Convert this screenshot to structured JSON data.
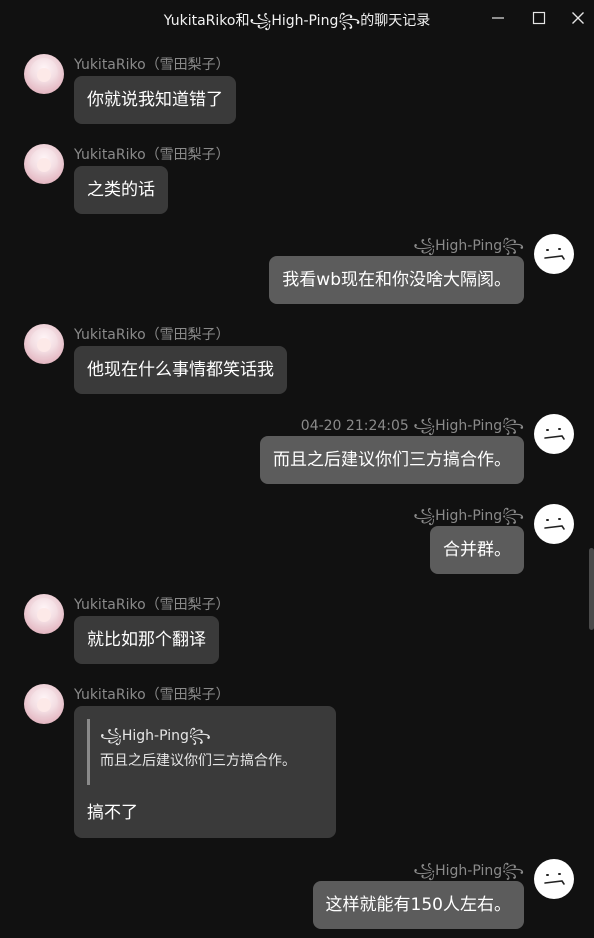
{
  "window": {
    "title": "YukitaRiko和🕹High-Ping🕹的聊天记录",
    "title_text": "YukitaRiko和꧁High-Ping꧂的聊天记录"
  },
  "contacts": {
    "left_name": "YukitaRiko（雪田梨子）",
    "right_name": "꧁High-Ping꧂"
  },
  "messages": [
    {
      "side": "left",
      "name": "YukitaRiko（雪田梨子）",
      "text": "你就说我知道错了"
    },
    {
      "side": "left",
      "name": "YukitaRiko（雪田梨子）",
      "text": "之类的话"
    },
    {
      "side": "right",
      "name": "꧁High-Ping꧂",
      "text": "我看wb现在和你没啥大隔阂。"
    },
    {
      "side": "left",
      "name": "YukitaRiko（雪田梨子）",
      "text": "他现在什么事情都笑话我"
    },
    {
      "side": "right",
      "name": "04-20 21:24:05 ꧁High-Ping꧂",
      "text": "而且之后建议你们三方搞合作。"
    },
    {
      "side": "right",
      "name": "꧁High-Ping꧂",
      "text": "合并群。"
    },
    {
      "side": "left",
      "name": "YukitaRiko（雪田梨子）",
      "text": "就比如那个翻译"
    },
    {
      "side": "left",
      "name": "YukitaRiko（雪田梨子）",
      "quote_author": "꧁High-Ping꧂",
      "quote_text": "而且之后建议你们三方搞合作。",
      "text": "搞不了"
    },
    {
      "side": "right",
      "name": "꧁High-Ping꧂",
      "text": "这样就能有150人左右。"
    }
  ],
  "colors": {
    "background": "#111111",
    "bubble_left": "#3a3a3a",
    "bubble_right": "#5c5c5c",
    "name_text": "#8a8a8a"
  },
  "icons": {
    "minimize": "minimize-icon",
    "maximize": "maximize-icon",
    "close": "close-icon",
    "avatar_left": "anime-girl-avatar",
    "avatar_right": "meh-face-avatar"
  }
}
